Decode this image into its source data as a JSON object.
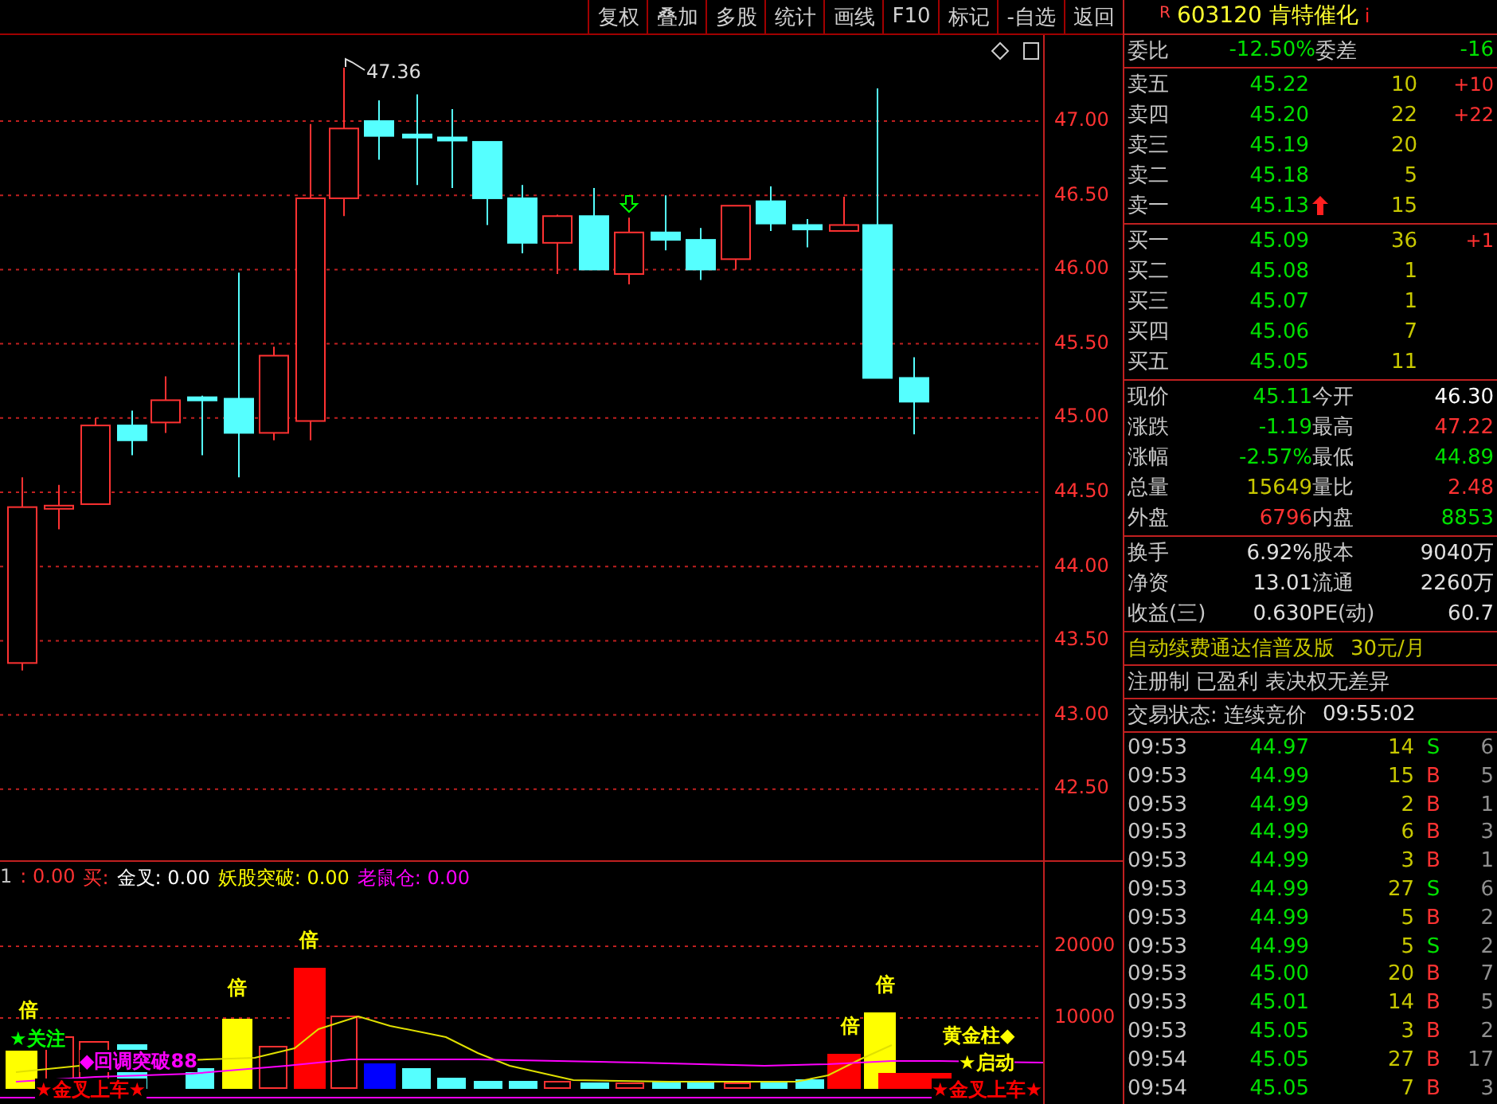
{
  "toolbar": [
    "复权",
    "叠加",
    "多股",
    "统计",
    "画线",
    "F10",
    "标记",
    "-自选",
    "返回"
  ],
  "chart": {
    "high_label": "47.36",
    "price_ticks": [
      "47.00",
      "46.50",
      "46.00",
      "45.50",
      "45.00",
      "44.50",
      "44.00",
      "43.50",
      "43.00",
      "42.50"
    ]
  },
  "indicator": {
    "legend": [
      {
        "text": "1",
        "color": "#c0c0c0"
      },
      {
        "text": ": 0.00",
        "color": "#ff3232"
      },
      {
        "text": "买:",
        "color": "#ff3232"
      },
      {
        "text": "金叉: 0.00",
        "color": "#ffffff"
      },
      {
        "text": "妖股突破: 0.00",
        "color": "#ffff00"
      },
      {
        "text": "老鼠仓: 0.00",
        "color": "#ff00ff"
      }
    ],
    "volume_ticks": [
      "20000",
      "10000"
    ],
    "signals": [
      {
        "text": "倍",
        "color": "#ffff00"
      },
      {
        "text": "倍",
        "color": "#ffff00"
      },
      {
        "text": "倍",
        "color": "#ffff00"
      },
      {
        "text": "倍",
        "color": "#ffff00"
      },
      {
        "text": "倍",
        "color": "#ffff00"
      },
      {
        "text": "★关注",
        "color": "#00ff00"
      },
      {
        "text": "◆回调突破88",
        "color": "#ff00ff"
      },
      {
        "text": "★金叉上车★",
        "color": "#ff0000"
      },
      {
        "text": "黄金柱◆",
        "color": "#ffff00"
      },
      {
        "text": "★启动",
        "color": "#ffff00"
      },
      {
        "text": "★金叉上车★",
        "color": "#ff0000"
      }
    ]
  },
  "quote": {
    "badge": "R",
    "code": "603120",
    "name": "肯特催化",
    "info": "i"
  },
  "order_ratio": [
    {
      "label": "委比",
      "value": "-12.50%"
    },
    {
      "label": "委差",
      "value": "-16"
    }
  ],
  "asks": [
    {
      "label": "卖五",
      "price": "45.22",
      "volume": "10",
      "change": "+10",
      "up_arrow": false
    },
    {
      "label": "卖四",
      "price": "45.20",
      "volume": "22",
      "change": "+22",
      "up_arrow": false
    },
    {
      "label": "卖三",
      "price": "45.19",
      "volume": "20",
      "up_arrow": false
    },
    {
      "label": "卖二",
      "price": "45.18",
      "volume": "5",
      "up_arrow": false
    },
    {
      "label": "卖一",
      "price": "45.13",
      "volume": "15",
      "up_arrow": true
    }
  ],
  "bids": [
    {
      "label": "买一",
      "price": "45.09",
      "volume": "36",
      "change": "+1",
      "up_arrow": false
    },
    {
      "label": "买二",
      "price": "45.08",
      "volume": "1",
      "up_arrow": false
    },
    {
      "label": "买三",
      "price": "45.07",
      "volume": "1",
      "up_arrow": false
    },
    {
      "label": "买四",
      "price": "45.06",
      "volume": "7",
      "up_arrow": false
    },
    {
      "label": "买五",
      "price": "45.05",
      "volume": "11",
      "up_arrow": false
    }
  ],
  "stats": [
    {
      "label": "现价",
      "value": "45.11",
      "color": "#00e000"
    },
    {
      "label": "今开",
      "value": "46.30",
      "color": "#ffffff"
    },
    {
      "label": "涨跌",
      "value": "-1.19",
      "color": "#00e000"
    },
    {
      "label": "最高",
      "value": "47.22",
      "color": "#ff3232"
    },
    {
      "label": "涨幅",
      "value": "-2.57%",
      "color": "#00e000"
    },
    {
      "label": "最低",
      "value": "44.89",
      "color": "#00e000"
    },
    {
      "label": "总量",
      "value": "15649",
      "color": "#c8c800"
    },
    {
      "label": "量比",
      "value": "2.48",
      "color": "#ff3232"
    },
    {
      "label": "外盘",
      "value": "6796",
      "color": "#ff3232"
    },
    {
      "label": "内盘",
      "value": "8853",
      "color": "#00e000"
    }
  ],
  "fundamentals": [
    {
      "label": "换手",
      "value": "6.92%"
    },
    {
      "label": "股本",
      "value": "9040万"
    },
    {
      "label": "净资",
      "value": "13.01"
    },
    {
      "label": "流通",
      "value": "2260万"
    },
    {
      "label": "收益(三)",
      "value": "0.630"
    },
    {
      "label": "PE(动)",
      "value": "60.7"
    }
  ],
  "promo": {
    "text": "自动续费通达信普及版",
    "price": "30元/月"
  },
  "tags": "注册制 已盈利 表决权无差异",
  "status": {
    "label": "交易状态: 连续竞价",
    "time": "09:55:02"
  },
  "trades": [
    {
      "time": "09:53",
      "price": "44.97",
      "volume": "14",
      "side": "S",
      "kind": "sell",
      "count": "6"
    },
    {
      "time": "09:53",
      "price": "44.99",
      "volume": "15",
      "side": "B",
      "kind": "buy",
      "count": "5"
    },
    {
      "time": "09:53",
      "price": "44.99",
      "volume": "2",
      "side": "B",
      "kind": "buy",
      "count": "1"
    },
    {
      "time": "09:53",
      "price": "44.99",
      "volume": "6",
      "side": "B",
      "kind": "buy",
      "count": "3"
    },
    {
      "time": "09:53",
      "price": "44.99",
      "volume": "3",
      "side": "B",
      "kind": "buy",
      "count": "1"
    },
    {
      "time": "09:53",
      "price": "44.99",
      "volume": "27",
      "side": "S",
      "kind": "sell",
      "count": "6"
    },
    {
      "time": "09:53",
      "price": "44.99",
      "volume": "5",
      "side": "B",
      "kind": "buy",
      "count": "2"
    },
    {
      "time": "09:53",
      "price": "44.99",
      "volume": "5",
      "side": "S",
      "kind": "sell",
      "count": "2"
    },
    {
      "time": "09:53",
      "price": "45.00",
      "volume": "20",
      "side": "B",
      "kind": "buy",
      "count": "7"
    },
    {
      "time": "09:53",
      "price": "45.01",
      "volume": "14",
      "side": "B",
      "kind": "buy",
      "count": "5"
    },
    {
      "time": "09:53",
      "price": "45.05",
      "volume": "3",
      "side": "B",
      "kind": "buy",
      "count": "2"
    },
    {
      "time": "09:54",
      "price": "45.05",
      "volume": "27",
      "side": "B",
      "kind": "buy",
      "count": "17"
    },
    {
      "time": "09:54",
      "price": "45.05",
      "volume": "7",
      "side": "B",
      "kind": "buy",
      "count": "3"
    }
  ]
}
